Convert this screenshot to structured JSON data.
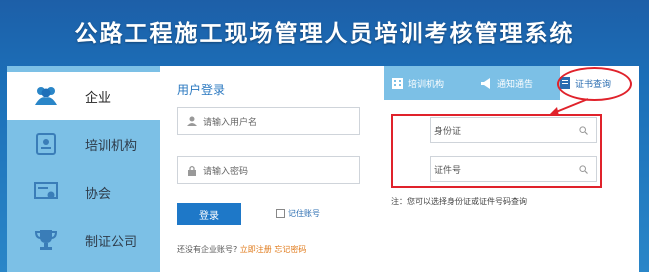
{
  "header": {
    "title": "公路工程施工现场管理人员培训考核管理系统"
  },
  "sidebar": {
    "items": [
      {
        "label": "企业",
        "icon": "users-icon"
      },
      {
        "label": "培训机构",
        "icon": "book-icon"
      },
      {
        "label": "协会",
        "icon": "certificate-icon"
      },
      {
        "label": "制证公司",
        "icon": "trophy-icon"
      }
    ]
  },
  "login": {
    "title": "用户登录",
    "username_placeholder": "请输入用户名",
    "password_placeholder": "请输入密码",
    "login_button": "登录",
    "remember_label": "记住账号",
    "register_prompt": "还没有企业账号?",
    "register_link": "立即注册",
    "forgot_link": "忘记密码"
  },
  "tabs": [
    {
      "label": "培训机构",
      "icon": "building-icon"
    },
    {
      "label": "通知通告",
      "icon": "megaphone-icon"
    },
    {
      "label": "证书查询",
      "icon": "document-icon"
    }
  ],
  "query": {
    "id_card_label": "身份证",
    "cert_no_label": "证件号",
    "note": "注：您可以选择身份证或证件号码查询"
  },
  "colors": {
    "accent": "#1e78c8",
    "highlight": "#e0222b",
    "link": "#e07a1a"
  }
}
